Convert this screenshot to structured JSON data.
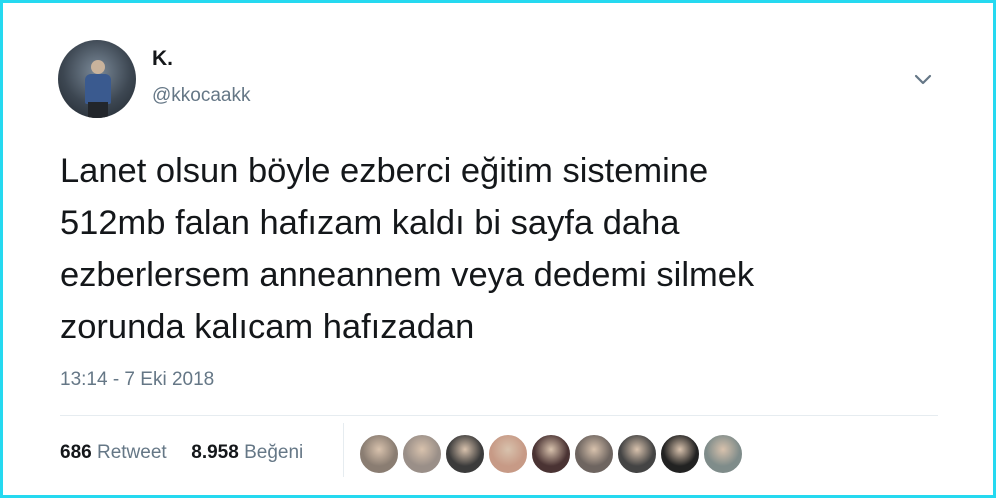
{
  "author": {
    "display_name": "K.",
    "handle": "@kkocaakk",
    "avatar_icon": "user-photo-avatar"
  },
  "menu": {
    "icon": "chevron-down-icon"
  },
  "tweet": {
    "lines": [
      "Lanet olsun böyle ezberci eğitim sistemine",
      "512mb falan hafızam kaldı bi sayfa daha",
      "ezberlersem anneannem veya dedemi silmek",
      "zorunda kalıcam hafızadan"
    ],
    "timestamp": "13:14 - 7 Eki 2018"
  },
  "stats": {
    "retweet_count": "686",
    "retweet_label": "Retweet",
    "like_count": "8.958",
    "like_label": "Beğeni"
  },
  "likers": {
    "icon": "user-avatar",
    "colors": [
      "#8a7d72",
      "#9a8f88",
      "#3b3b3b",
      "#c79a86",
      "#4a3333",
      "#6e6560",
      "#444444",
      "#222222",
      "#7f8c8a"
    ]
  },
  "colors": {
    "frame_border": "#25d9f0",
    "text_primary": "#14171a",
    "text_secondary": "#657786",
    "divider": "#e6ecf0"
  }
}
